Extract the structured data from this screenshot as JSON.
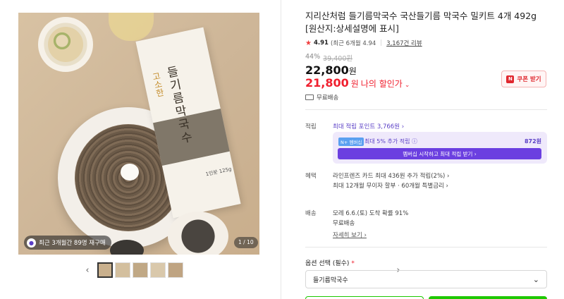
{
  "gallery": {
    "page_indicator": "1 / 10",
    "rebuy_badge": "최근 3개월간 89명 재구매",
    "pack_title": "들기름막국수",
    "pack_subtitle": "고소한",
    "pack_foot": "1인분 125g",
    "prev_arrow": "‹",
    "next_arrow": "›"
  },
  "product": {
    "title": "지리산처럼 들기름막국수 국산들기름 막국수 밀키트 4개 492g [원산지:상세설명에 표시]",
    "rating": "4.91",
    "recent_rating": "(최근 6개월 4.94",
    "reviews": "3,167건 리뷰",
    "discount_pct": "44%",
    "original_price": "39,400원",
    "price": "22,800",
    "price_unit": "원",
    "sale_price": "21,800",
    "sale_unit": "원",
    "sale_label": "나의 할인가",
    "coupon_label": "쿠폰 받기",
    "coupon_icon": "N",
    "shipping_top": "무료배송"
  },
  "points": {
    "label": "적립",
    "link": "최대 적립 포인트 3,766원 ›",
    "membership_tag": "N+ 멤버십",
    "membership_text": "최대 5% 추가 적립 ⓘ",
    "membership_amount": "872원",
    "membership_button": "멤버십 시작하고 최대 적립 받기 ›"
  },
  "benefits": {
    "label": "혜택",
    "items": [
      "라인프렌즈 카드 최대 436원 추가 적립(2%) ›",
      "최대 12개월 무이자 할부 · 60개월 특별금리 ›"
    ]
  },
  "delivery": {
    "label": "배송",
    "arrival": "모레 6.6.(토) 도착 확률 91%",
    "fee": "무료배송",
    "details_link": "자세히 보기 ›"
  },
  "options": {
    "label": "옵션 선택 (필수)",
    "required_mark": "*",
    "selected": "들기름막국수",
    "chevron": "⌄"
  },
  "icons": [
    "chevron-left-icon",
    "chevron-right-icon",
    "star-icon",
    "truck-icon",
    "chevron-down-icon",
    "coupon-icon"
  ],
  "colors": {
    "sale": "#f0202f",
    "membership": "#6b3fe0",
    "buy": "#1ec800"
  }
}
